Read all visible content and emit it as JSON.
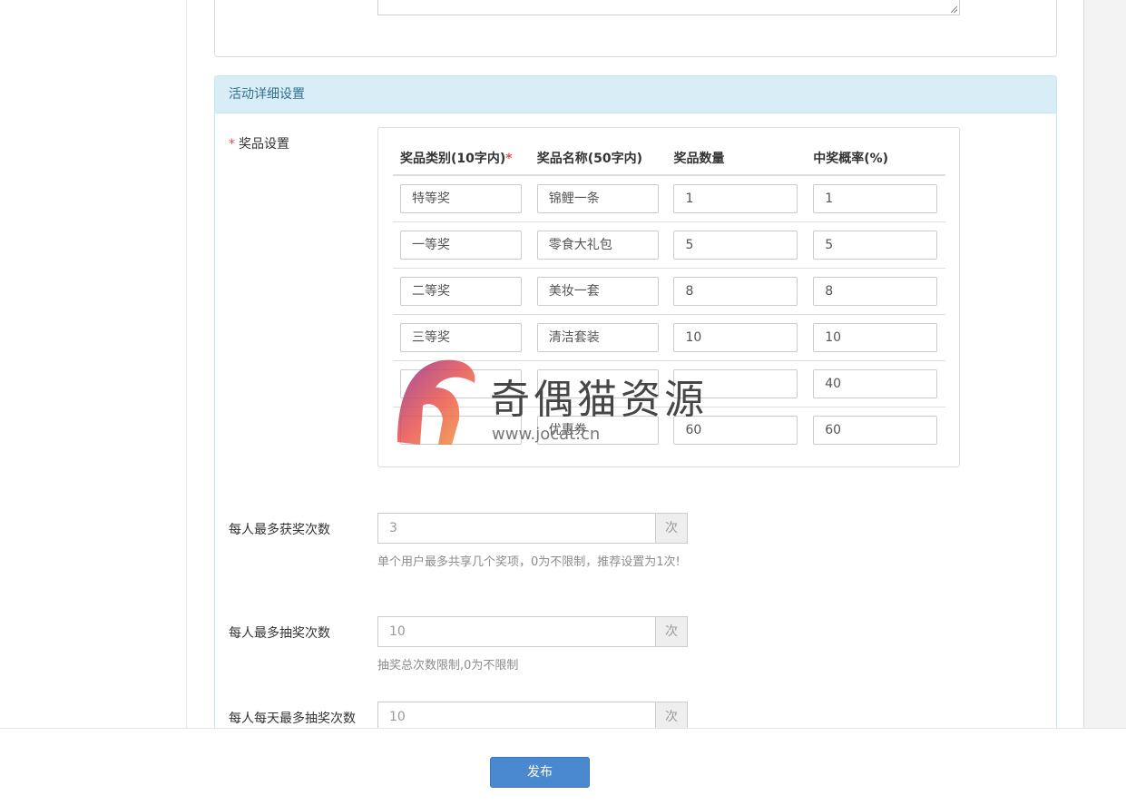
{
  "panel": {
    "heading": "活动详细设置"
  },
  "prize_settings": {
    "label": "奖品设置",
    "required_mark": "*",
    "columns": [
      {
        "text": "奖品类别(10字内)",
        "required": "*"
      },
      {
        "text": "奖品名称(50字内)",
        "required": ""
      },
      {
        "text": "奖品数量",
        "required": ""
      },
      {
        "text": "中奖概率(%)",
        "required": ""
      }
    ],
    "rows": [
      {
        "category": "特等奖",
        "name": "锦鲤一条",
        "quantity": "1",
        "probability": "1"
      },
      {
        "category": "一等奖",
        "name": "零食大礼包",
        "quantity": "5",
        "probability": "5"
      },
      {
        "category": "二等奖",
        "name": "美妆一套",
        "quantity": "8",
        "probability": "8"
      },
      {
        "category": "三等奖",
        "name": "清洁套装",
        "quantity": "10",
        "probability": "10"
      },
      {
        "category": "",
        "name": "",
        "quantity": "",
        "probability": "40"
      },
      {
        "category": "",
        "name": "优惠券",
        "quantity": "60",
        "probability": "60"
      }
    ]
  },
  "fields": {
    "max_wins": {
      "label": "每人最多获奖次数",
      "value": "3",
      "unit": "次",
      "help": "单个用户最多共享几个奖项，0为不限制，推荐设置为1次!"
    },
    "max_draws": {
      "label": "每人最多抽奖次数",
      "value": "10",
      "unit": "次",
      "help": "抽奖总次数限制,0为不限制"
    },
    "max_daily_draws": {
      "label": "每人每天最多抽奖次数",
      "value": "10",
      "unit": "次"
    }
  },
  "actions": {
    "publish": "发布"
  },
  "watermark": {
    "text": "奇偶猫资源",
    "url": "www.jocat.cn",
    "logo_color": "#e8534f"
  }
}
